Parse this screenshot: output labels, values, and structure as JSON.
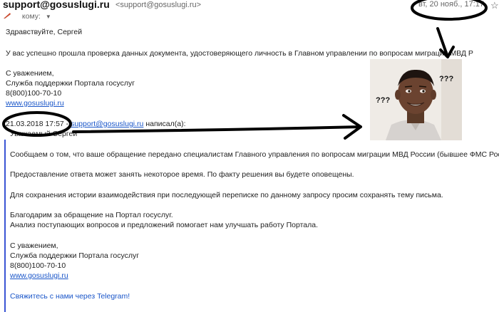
{
  "header": {
    "sender": "support@gosuslugi.ru",
    "sender_email": "<support@gosuslugi.ru>",
    "date": "вт, 20 нояб., 17:17",
    "to_label": "кому:",
    "dropdown_icon": "chevron-down-icon",
    "star_icon": "star-icon"
  },
  "body": {
    "greeting": "Здравствуйте, Сергей",
    "main_text": "У вас успешно прошла проверка данных документа, удостоверяющего личность в Главном управлении по вопросам миграции МВД Р",
    "sign_1": "С уважением,",
    "sign_2": "Служба поддержки Портала госуслуг",
    "sign_phone": "8(800)100-70-10",
    "sign_link": "www.gosuslugi.ru"
  },
  "quote": {
    "date": "21.03.2018 17:57 -",
    "email": "support@gosuslugi.ru",
    "wrote": "написал(а):",
    "salutation": "Уважаемый Сергей",
    "p1": "Сообщаем о том, что ваше обращение передано специалистам Главного управления по вопросам миграции МВД России (бывшее ФМС России).",
    "p2": "Предоставление ответа может занять некоторое время. По факту решения вы будете оповещены.",
    "p3": "Для сохранения истории взаимодействия при последующей переписке по данному  запросу просим сохранять тему письма.",
    "p4a": "Благодарим за обращение на Портал госуслуг.",
    "p4b": "Анализ поступающих вопросов и предложений помогает нам улучшать работу Портала.",
    "sign_1": "С уважением,",
    "sign_2": "Служба поддержки Портала госуслуг",
    "sign_phone": "8(800)100-70-10",
    "sign_link": "www.gosuslugi.ru",
    "telegram": "Свяжитесь с нами через Telegram!"
  },
  "meme": {
    "q1": "???",
    "q2": "???"
  },
  "colors": {
    "link": "#1a56c9",
    "quote_bar": "#3a55d4",
    "annotation": "#000000"
  }
}
